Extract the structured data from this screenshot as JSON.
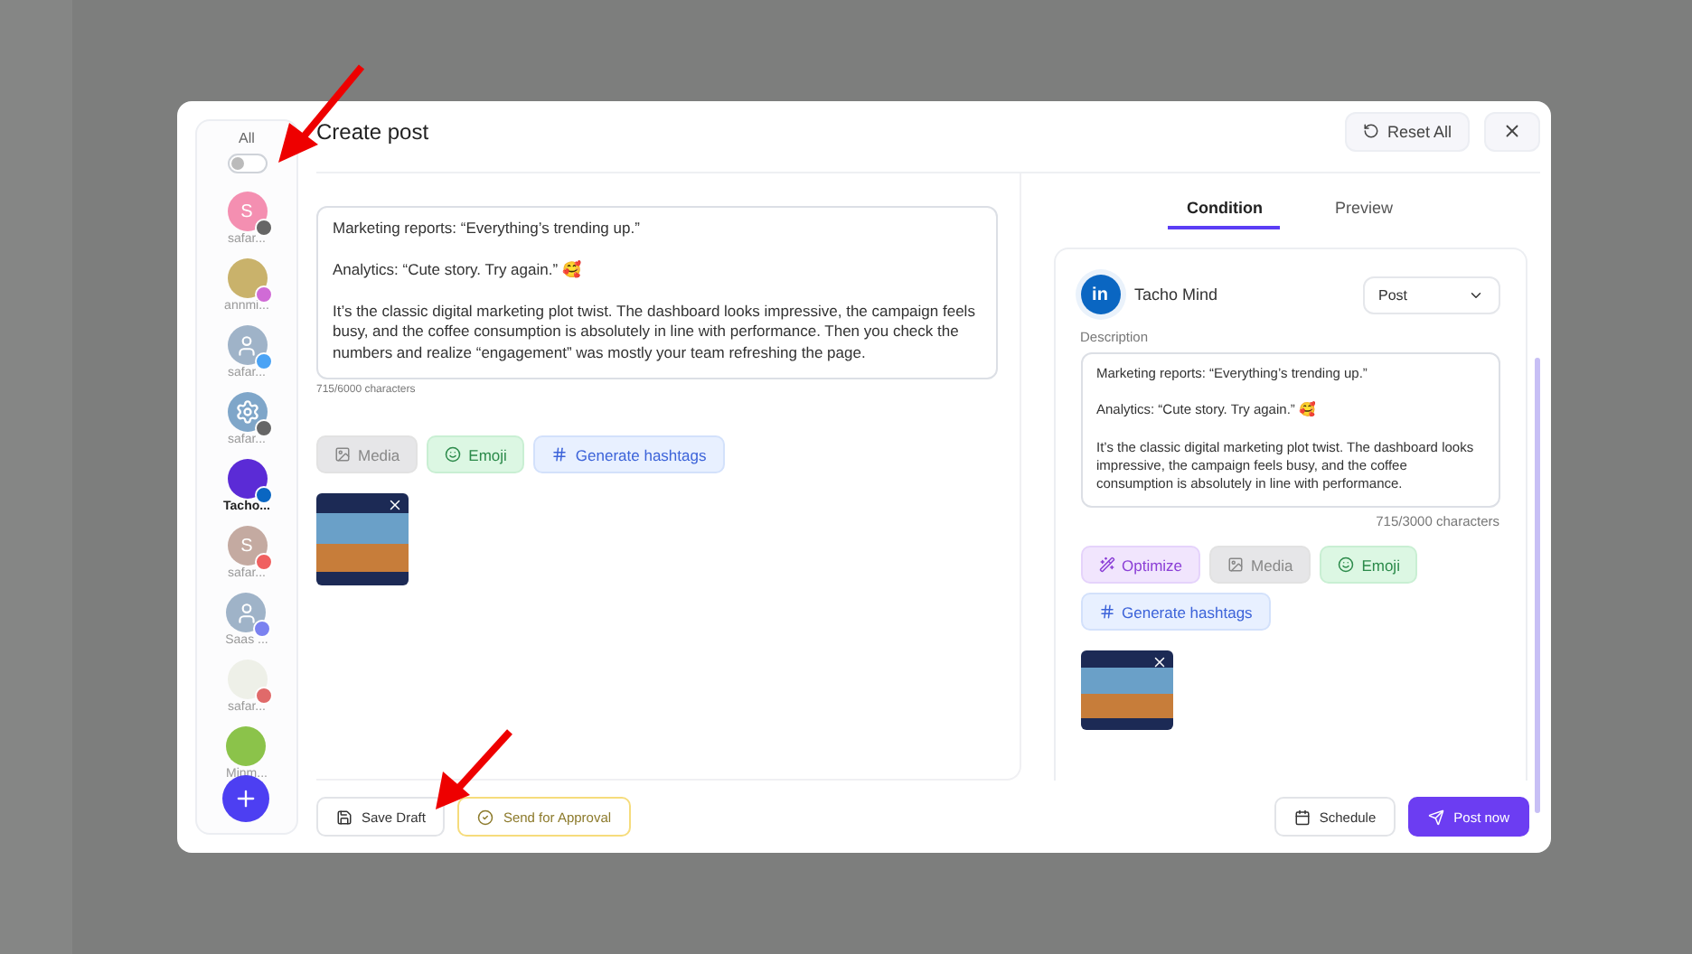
{
  "accounts_panel": {
    "all_label": "All",
    "select_all_on": false,
    "accounts": [
      {
        "label": "safar...",
        "avatar": {
          "kind": "letter",
          "initial": "S",
          "color": "#f48fb1"
        },
        "badge": {
          "color": "#666666"
        },
        "selected": false
      },
      {
        "label": "annmi...",
        "avatar": {
          "kind": "photo",
          "color": "#c9b26b"
        },
        "badge": {
          "color": "#d06bd6"
        },
        "selected": false
      },
      {
        "label": "safar...",
        "avatar": {
          "kind": "silhouette",
          "color": "#9fb3c8"
        },
        "badge": {
          "color": "#4aa3f5"
        },
        "selected": false
      },
      {
        "label": "safar...",
        "avatar": {
          "kind": "gear",
          "color": "#7fa6c9"
        },
        "badge": {
          "color": "#666666"
        },
        "selected": false
      },
      {
        "label": "Tacho...",
        "avatar": {
          "kind": "photo",
          "color": "#5b2bd6"
        },
        "badge": {
          "color": "#0a66c2"
        },
        "selected": true
      },
      {
        "label": "safar...",
        "avatar": {
          "kind": "letter",
          "initial": "S",
          "color": "#c4aaa1"
        },
        "badge": {
          "color": "#f06060"
        },
        "selected": false
      },
      {
        "label": "Saas ...",
        "avatar": {
          "kind": "silhouette",
          "color": "#9fb3c8"
        },
        "badge": {
          "color": "#7b82f0"
        },
        "selected": false
      },
      {
        "label": "safar...",
        "avatar": {
          "kind": "photo",
          "color": "#eef0e8"
        },
        "badge": {
          "color": "#e06a6a"
        },
        "selected": false
      },
      {
        "label": "Minm...",
        "avatar": {
          "kind": "photo",
          "color": "#8bc34a"
        },
        "selected": false
      }
    ]
  },
  "modal": {
    "title": "Create post",
    "reset_label": "Reset All"
  },
  "editor": {
    "text": "Marketing reports: “Everything’s trending up.”\n\nAnalytics: “Cute story. Try again.” 🥰\n\nIt’s the classic digital marketing plot twist. The dashboard looks impressive, the campaign feels busy, and the coffee consumption is absolutely in line with performance. Then you check the numbers and realize “engagement” was mostly your team refreshing the page.",
    "counter": "715/6000 characters",
    "tools": [
      {
        "kind": "media",
        "label": "Media",
        "disabled": true
      },
      {
        "kind": "emoji",
        "label": "Emoji",
        "disabled": false
      },
      {
        "kind": "hashtags",
        "label": "Generate hashtags",
        "disabled": false
      }
    ]
  },
  "tabs": [
    {
      "label": "Condition",
      "selected": true
    },
    {
      "label": "Preview",
      "selected": false
    }
  ],
  "condition": {
    "logo_text": "in",
    "account_name": "Tacho Mind",
    "post_type": "Post",
    "description_label": "Description",
    "text": "Marketing reports: “Everything’s trending up.”\n\nAnalytics: “Cute story. Try again.” 🥰\n\nIt’s the classic digital marketing plot twist. The dashboard looks impressive, the campaign feels busy, and the coffee consumption is absolutely in line with performance.",
    "counter": "715/3000 characters",
    "tools": [
      {
        "kind": "optimize",
        "label": "Optimize",
        "disabled": false
      },
      {
        "kind": "media",
        "label": "Media",
        "disabled": true
      },
      {
        "kind": "emoji",
        "label": "Emoji",
        "disabled": false
      },
      {
        "kind": "hashtags",
        "label": "Generate hashtags",
        "disabled": false
      }
    ]
  },
  "footer": {
    "left": [
      {
        "kind": "draft",
        "label": "Save Draft"
      },
      {
        "kind": "approval",
        "label": "Send for Approval"
      }
    ],
    "right": [
      {
        "kind": "schedule",
        "label": "Schedule"
      },
      {
        "kind": "post",
        "label": "Post now"
      }
    ]
  }
}
